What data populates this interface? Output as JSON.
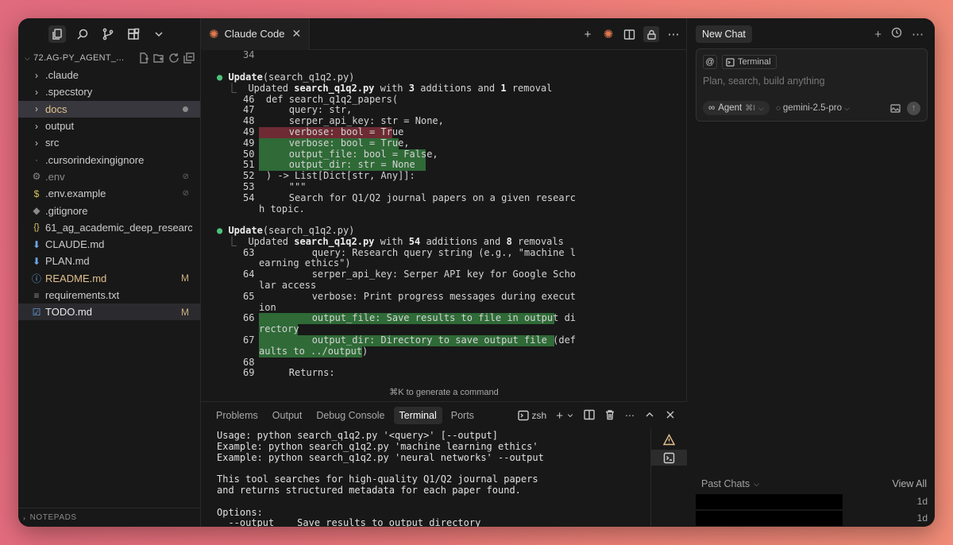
{
  "sidebar": {
    "project_title": "72.AG-PY_AGENT_...",
    "items": [
      {
        "label": ".claude",
        "icon": "chevron-right-icon"
      },
      {
        "label": ".specstory",
        "icon": "chevron-right-icon"
      },
      {
        "label": "docs",
        "icon": "chevron-right-icon"
      },
      {
        "label": "output",
        "icon": "chevron-right-icon"
      },
      {
        "label": "src",
        "icon": "chevron-right-icon"
      },
      {
        "label": ".cursorindexingignore",
        "icon": "file-icon"
      },
      {
        "label": ".env",
        "icon": "gear-icon"
      },
      {
        "label": ".env.example",
        "icon": "dollar-icon"
      },
      {
        "label": ".gitignore",
        "icon": "git-icon"
      },
      {
        "label": "61_ag_academic_deep_research...",
        "icon": "json-icon"
      },
      {
        "label": "CLAUDE.md",
        "icon": "markdown-icon"
      },
      {
        "label": "PLAN.md",
        "icon": "markdown-icon"
      },
      {
        "label": "README.md",
        "icon": "info-icon",
        "badge": "M"
      },
      {
        "label": "requirements.txt",
        "icon": "lines-icon"
      },
      {
        "label": "TODO.md",
        "icon": "checkbox-icon",
        "badge": "M"
      }
    ],
    "notepads_label": "NOTEPADS"
  },
  "editor": {
    "tab_label": "Claude Code",
    "hint": "⌘K to generate a command",
    "update1": {
      "title_kw": "Update",
      "title_rest": "(search_q1q2.py)",
      "summary_pre": "Updated ",
      "file": "search_q1q2.py",
      "mid1": " with ",
      "n1": "3",
      "mid2": " additions and ",
      "n2": "1",
      "end": " removal"
    },
    "update2": {
      "title_kw": "Update",
      "title_rest": "(search_q1q2.py)",
      "summary_pre": "Updated ",
      "file": "search_q1q2.py",
      "mid1": " with ",
      "n1": "54",
      "mid2": " additions and ",
      "n2": "8",
      "end": " removals"
    },
    "lines": {
      "l34": "34",
      "l46": "46  def search_q1q2_papers(",
      "l47": "47      query: str,",
      "l48": "48      serper_api_key: str = None,",
      "l49r": "49      verbose: bool = True",
      "l49g": "49      verbose: bool = True,",
      "l50": "50      output_file: bool = False,",
      "l51": "51      output_dir: str = None",
      "l52": "52  ) -> List[Dict[str, Any]]:",
      "l53": "53      \"\"\"",
      "l54": "54      Search for Q1/Q2 journal papers on a given researc",
      "l54b": "h topic.",
      "l63": "63          query: Research query string (e.g., \"machine l",
      "l63b": "earning ethics\")",
      "l64": "64          serper_api_key: Serper API key for Google Scho",
      "l64b": "lar access",
      "l65": "65          verbose: Print progress messages during execut",
      "l65b": "ion",
      "l66": "66          output_file: Save results to file in output di",
      "l66b": "rectory",
      "l67": "67          output_dir: Directory to save output file (def",
      "l67b": "aults to ../output)",
      "l68": "68",
      "l69": "69      Returns:"
    }
  },
  "panel": {
    "tabs": [
      "Problems",
      "Output",
      "Debug Console",
      "Terminal",
      "Ports"
    ],
    "shell": "zsh",
    "terminal_lines": [
      "Usage: python search_q1q2.py '<query>' [--output]",
      "Example: python search_q1q2.py 'machine learning ethics'",
      "Example: python search_q1q2.py 'neural networks' --output",
      "",
      "This tool searches for high-quality Q1/Q2 journal papers",
      "and returns structured metadata for each paper found.",
      "",
      "Options:",
      "  --output    Save results to output directory"
    ]
  },
  "chat": {
    "new_chat": "New Chat",
    "context_chip": "Terminal",
    "at_symbol": "@",
    "placeholder": "Plan, search, build anything",
    "agent_label": "Agent",
    "agent_kbd": "⌘I",
    "model": "gemini-2.5-pro",
    "past_chats": "Past Chats",
    "view_all": "View All",
    "history": [
      {
        "age": "1d"
      },
      {
        "age": "1d"
      }
    ]
  },
  "colors": {
    "accent_orange": "#e07a4f",
    "added_line": "#2f6a37",
    "removed_line": "#6e2b33",
    "bullet_green": "#4ec17a"
  }
}
